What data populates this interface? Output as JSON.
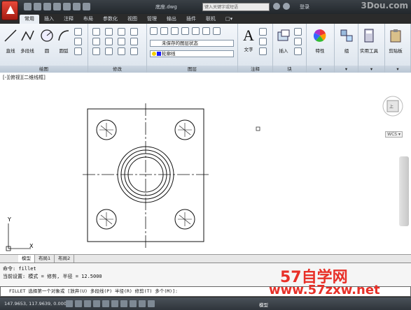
{
  "titlebar": {
    "doc_title": "底座.dwg",
    "search_placeholder": "键入关键字或短语",
    "login": "登录",
    "watermark_top": "3Dou.com"
  },
  "tabs": [
    "常用",
    "插入",
    "注释",
    "布局",
    "参数化",
    "视图",
    "管理",
    "输出",
    "插件",
    "联机",
    "□▾"
  ],
  "ribbon": {
    "draw": {
      "title": "绘图",
      "line": "直线",
      "polyline": "多段线",
      "circle": "圆",
      "arc": "圆弧"
    },
    "modify": {
      "title": "修改"
    },
    "layers": {
      "title": "图层",
      "state": "未保存的图层状态",
      "current": "轮廓线"
    },
    "annotation": {
      "title": "注释",
      "text": "文字"
    },
    "block": {
      "title": "块",
      "insert": "插入"
    },
    "properties": {
      "label": "特性"
    },
    "groups": {
      "label": "组"
    },
    "utilities": {
      "label": "实用工具"
    },
    "clipboard": {
      "label": "剪贴板"
    }
  },
  "viewport": {
    "label": "[-][俯视][二维线框]",
    "cube_face": "上",
    "wcs": "WCS ▾"
  },
  "ucs": {
    "x": "X",
    "y": "Y"
  },
  "layout_tabs": [
    "模型",
    "布局1",
    "布局2"
  ],
  "command": {
    "line1": "命令:  fillet",
    "line2": "当前设置: 模式 = 修剪, 半径 = 12.5000",
    "prompt": "FILLET 选择第一个对象或 [放弃(U) 多段线(P) 半径(R) 修剪(T) 多个(M)]:"
  },
  "status": {
    "coords": "147.9653, 117.9639, 0.0000",
    "model": "模型"
  },
  "watermark": {
    "brand": "57自学网",
    "url": "www.57zxw.net"
  },
  "colors": {
    "accent": "#e83028",
    "layer_color": "#1a1aff"
  }
}
